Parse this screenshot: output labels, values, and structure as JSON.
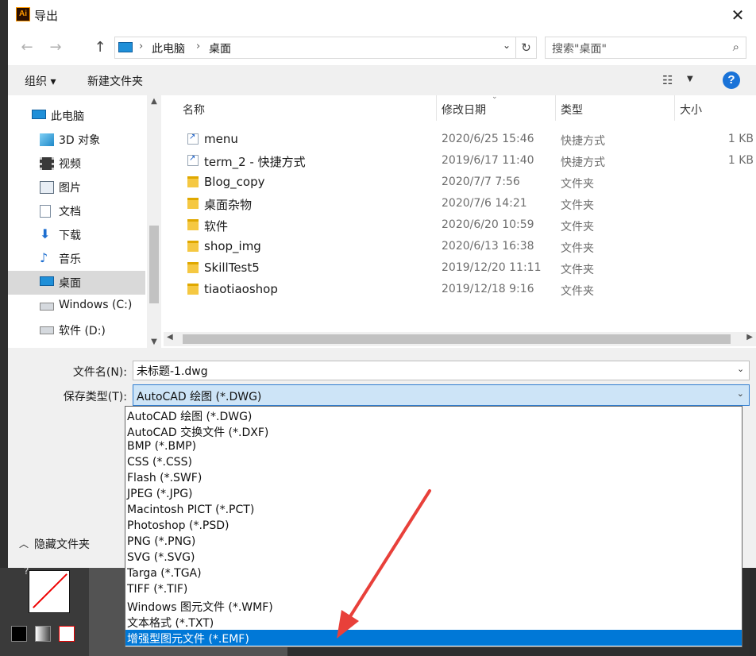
{
  "window": {
    "title": "导出",
    "app_icon": "Ai",
    "close_icon": "close-icon"
  },
  "address": {
    "crumbs": [
      "此电脑",
      "桌面"
    ],
    "search_placeholder": "搜索\"桌面\""
  },
  "toolbar": {
    "organize": "组织 ▾",
    "new_folder": "新建文件夹",
    "help": "?"
  },
  "nav": {
    "items": [
      {
        "label": "此电脑",
        "icon": "computer-icon"
      },
      {
        "label": "3D 对象",
        "icon": "cube-3d-icon"
      },
      {
        "label": "视频",
        "icon": "video-icon"
      },
      {
        "label": "图片",
        "icon": "picture-icon"
      },
      {
        "label": "文档",
        "icon": "document-icon"
      },
      {
        "label": "下载",
        "icon": "download-icon"
      },
      {
        "label": "音乐",
        "icon": "music-icon"
      },
      {
        "label": "桌面",
        "icon": "desktop-icon",
        "selected": true
      },
      {
        "label": "Windows (C:)",
        "icon": "drive-c-icon"
      },
      {
        "label": "软件 (D:)",
        "icon": "drive-d-icon"
      }
    ]
  },
  "columns": {
    "name": "名称",
    "modified": "修改日期",
    "type": "类型",
    "size": "大小"
  },
  "files": [
    {
      "name": "menu",
      "date": "2020/6/25 15:46",
      "type": "快捷方式",
      "size": "1 KB",
      "kind": "shortcut"
    },
    {
      "name": "term_2 - 快捷方式",
      "date": "2019/6/17 11:40",
      "type": "快捷方式",
      "size": "1 KB",
      "kind": "shortcut"
    },
    {
      "name": "Blog_copy",
      "date": "2020/7/7 7:56",
      "type": "文件夹",
      "size": "",
      "kind": "folder"
    },
    {
      "name": "桌面杂物",
      "date": "2020/7/6 14:21",
      "type": "文件夹",
      "size": "",
      "kind": "folder"
    },
    {
      "name": "软件",
      "date": "2020/6/20 10:59",
      "type": "文件夹",
      "size": "",
      "kind": "folder"
    },
    {
      "name": "shop_img",
      "date": "2020/6/13 16:38",
      "type": "文件夹",
      "size": "",
      "kind": "folder"
    },
    {
      "name": "SkillTest5",
      "date": "2019/12/20 11:11",
      "type": "文件夹",
      "size": "",
      "kind": "folder"
    },
    {
      "name": "tiaotiaoshop",
      "date": "2019/12/18 9:16",
      "type": "文件夹",
      "size": "",
      "kind": "folder"
    }
  ],
  "form": {
    "filename_label": "文件名(N):",
    "filename_value": "未标题-1.dwg",
    "type_label": "保存类型(T):",
    "type_value": "AutoCAD 绘图 (*.DWG)"
  },
  "type_options": [
    "AutoCAD 绘图 (*.DWG)",
    "AutoCAD 交换文件 (*.DXF)",
    "BMP (*.BMP)",
    "CSS (*.CSS)",
    "Flash (*.SWF)",
    "JPEG (*.JPG)",
    "Macintosh PICT (*.PCT)",
    "Photoshop (*.PSD)",
    "PNG (*.PNG)",
    "SVG (*.SVG)",
    "Targa (*.TGA)",
    "TIFF (*.TIF)",
    "Windows 图元文件 (*.WMF)",
    "文本格式 (*.TXT)",
    "增强型图元文件 (*.EMF)"
  ],
  "highlighted_option_index": 14,
  "hide_folders": "隐藏文件夹",
  "colors": {
    "selection": "#0078d7",
    "arrow": "#e8403a",
    "help": "#1a73d8"
  }
}
